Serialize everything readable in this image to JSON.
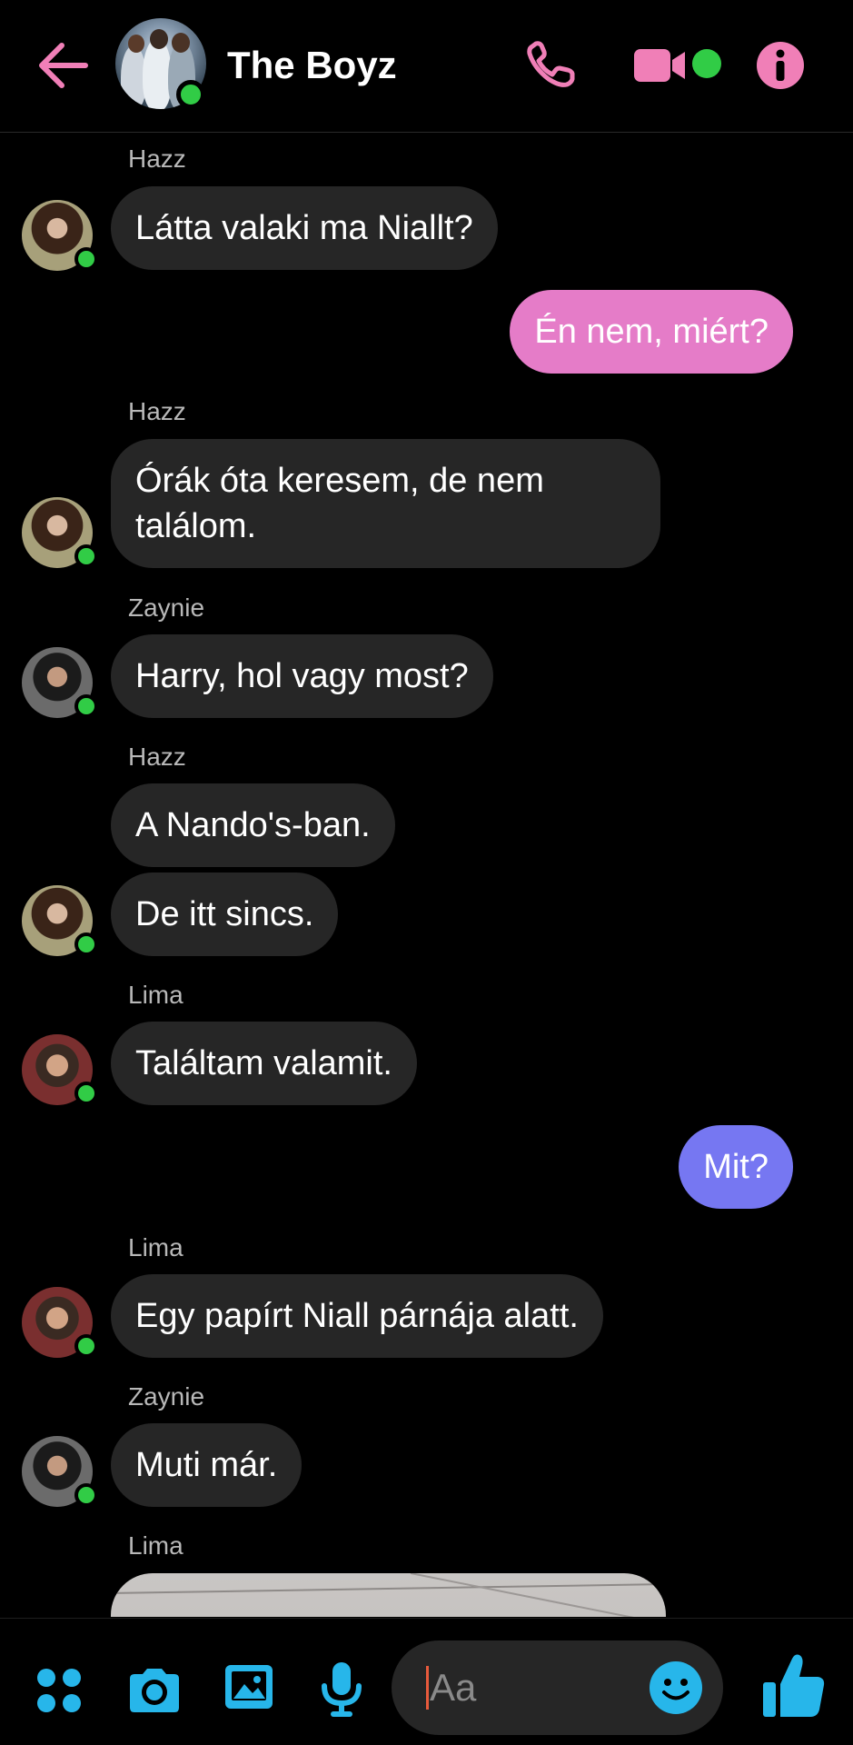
{
  "header": {
    "title": "The Boyz",
    "accent_color": "#f07fb7",
    "online_color": "#31cc46",
    "icons": [
      "back-arrow-icon",
      "phone-icon",
      "video-camera-icon",
      "info-icon"
    ]
  },
  "messages": [
    {
      "sender": "Hazz",
      "text": "Látta valaki ma Niallt?"
    },
    {
      "sender": "me",
      "text": "Én nem, miért?",
      "color": "#e57cc8"
    },
    {
      "sender": "Hazz",
      "text": "Órák óta keresem, de nem találom."
    },
    {
      "sender": "Zaynie",
      "text": "Harry, hol vagy most?"
    },
    {
      "sender": "Hazz",
      "text": "A Nando's-ban."
    },
    {
      "sender": "Hazz",
      "text": "De itt sincs."
    },
    {
      "sender": "Lima",
      "text": "Találtam valamit."
    },
    {
      "sender": "me",
      "text": "Mit?",
      "color": "#7677f2"
    },
    {
      "sender": "Lima",
      "text": "Egy papírt Niall párnája alatt."
    },
    {
      "sender": "Zaynie",
      "text": "Muti már."
    },
    {
      "sender": "Lima",
      "text": ""
    }
  ],
  "composer": {
    "placeholder": "Aa",
    "icon_color": "#27b6ea",
    "icons": [
      "apps-icon",
      "camera-icon",
      "gallery-icon",
      "microphone-icon",
      "emoji-icon",
      "thumbs-up-icon"
    ]
  }
}
